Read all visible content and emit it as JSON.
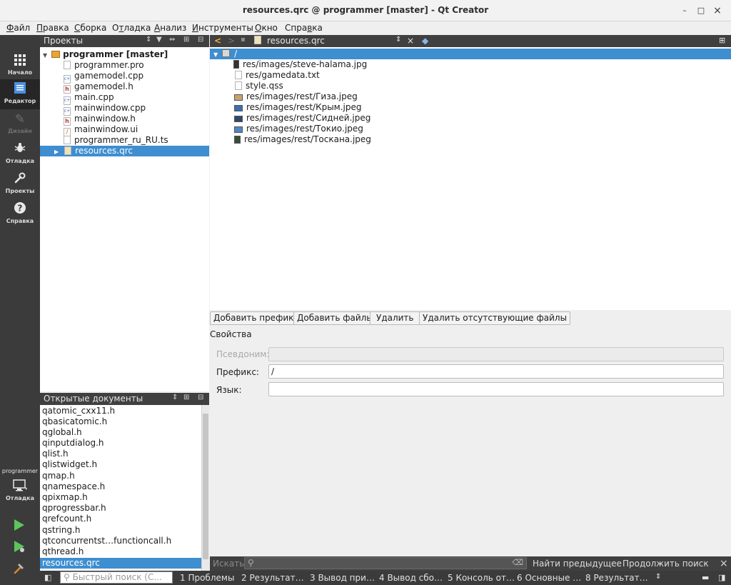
{
  "window": {
    "title": "resources.qrc @ programmer [master] - Qt Creator",
    "minimize": "–",
    "maximize": "□",
    "close": "×"
  },
  "menu": [
    {
      "hot": "Ф",
      "rest": "айл"
    },
    {
      "hot": "П",
      "rest": "равка"
    },
    {
      "hot": "С",
      "rest": "борка"
    },
    {
      "pre": "О",
      "hot": "т",
      "rest": "ладка"
    },
    {
      "hot": "А",
      "rest": "нализ"
    },
    {
      "hot": "И",
      "rest": "нструменты"
    },
    {
      "hot": "О",
      "rest": "кно"
    },
    {
      "pre": "Спра",
      "hot": "в",
      "rest": "ка"
    }
  ],
  "modes": {
    "start": "Начало",
    "editor": "Редактор",
    "design": "Дизайн",
    "debug": "Отладка",
    "projects": "Проекты",
    "help": "Справка",
    "target_project": "programmer",
    "target_mode": "Отладка"
  },
  "projects_panel": {
    "title": "Проекты",
    "root": "programmer [master]",
    "files": [
      "programmer.pro",
      "gamemodel.cpp",
      "gamemodel.h",
      "main.cpp",
      "mainwindow.cpp",
      "mainwindow.h",
      "mainwindow.ui",
      "programmer_ru_RU.ts",
      "resources.qrc"
    ]
  },
  "open_docs": {
    "title": "Открытые документы",
    "items": [
      "qatomic_cxx11.h",
      "qbasicatomic.h",
      "qglobal.h",
      "qinputdialog.h",
      "qlist.h",
      "qlistwidget.h",
      "qmap.h",
      "qnamespace.h",
      "qpixmap.h",
      "qprogressbar.h",
      "qrefcount.h",
      "qstring.h",
      "qtconcurrentst…functioncall.h",
      "qthread.h",
      "resources.qrc"
    ]
  },
  "editor": {
    "file": "resources.qrc",
    "root_prefix": "/",
    "resources": [
      "res/images/steve-halama.jpg",
      "res/gamedata.txt",
      "style.qss",
      "res/images/rest/Гиза.jpeg",
      "res/images/rest/Крым.jpeg",
      "res/images/rest/Сидней.jpeg",
      "res/images/rest/Токио.jpeg",
      "res/images/rest/Тоскана.jpeg"
    ],
    "buttons": {
      "add_prefix": "Добавить префикс",
      "add_files": "Добавить файлы",
      "remove": "Удалить",
      "remove_missing": "Удалить отсутствующие файлы"
    },
    "properties_title": "Свойства",
    "alias_label": "Псевдоним:",
    "alias_value": "",
    "prefix_label": "Префикс:",
    "prefix_value": "/",
    "lang_label": "Язык:",
    "lang_value": ""
  },
  "find": {
    "label": "Искать:",
    "find_prev": "Найти предыдущее",
    "continue": "Продолжить поиск"
  },
  "statusbar": {
    "quick_search_placeholder": "Быстрый поиск (С...",
    "tabs": [
      "1 Проблемы",
      "2 Результат…",
      "3 Вывод при…",
      "4 Вывод сбо…",
      "5 Консоль от…",
      "6 Основные …",
      "8 Результат…"
    ]
  },
  "colors": {
    "selection": "#3e8ed0",
    "panel_header": "#404040",
    "mode_bar": "#3b3b3b"
  }
}
